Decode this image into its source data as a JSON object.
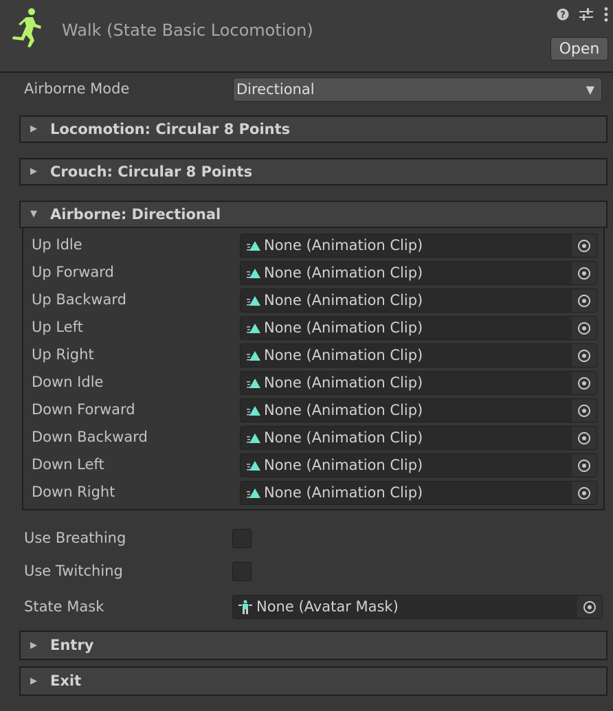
{
  "header": {
    "title": "Walk (State Basic Locomotion)",
    "open_button": "Open",
    "icons": [
      "runner-icon",
      "help-icon",
      "settings-sliders-icon",
      "more-vertical-icon"
    ],
    "runner_color": "#b5f16b"
  },
  "airborne_mode": {
    "label": "Airborne Mode",
    "value": "Directional"
  },
  "foldouts": [
    {
      "label": "Locomotion: Circular 8 Points",
      "expanded": false
    },
    {
      "label": "Crouch: Circular 8 Points",
      "expanded": false
    },
    {
      "label": "Airborne: Directional",
      "expanded": true
    }
  ],
  "airborne_clips": [
    {
      "label": "Up Idle",
      "value": "None (Animation Clip)"
    },
    {
      "label": "Up Forward",
      "value": "None (Animation Clip)"
    },
    {
      "label": "Up Backward",
      "value": "None (Animation Clip)"
    },
    {
      "label": "Up Left",
      "value": "None (Animation Clip)"
    },
    {
      "label": "Up Right",
      "value": "None (Animation Clip)"
    },
    {
      "label": "Down Idle",
      "value": "None (Animation Clip)"
    },
    {
      "label": "Down Forward",
      "value": "None (Animation Clip)"
    },
    {
      "label": "Down Backward",
      "value": "None (Animation Clip)"
    },
    {
      "label": "Down Left",
      "value": "None (Animation Clip)"
    },
    {
      "label": "Down Right",
      "value": "None (Animation Clip)"
    }
  ],
  "use_breathing": {
    "label": "Use Breathing",
    "checked": false
  },
  "use_twitching": {
    "label": "Use Twitching",
    "checked": false
  },
  "state_mask": {
    "label": "State Mask",
    "value": "None (Avatar Mask)"
  },
  "bottom_foldouts": [
    {
      "label": "Entry",
      "expanded": false
    },
    {
      "label": "Exit",
      "expanded": false
    }
  ],
  "accent_color": "#6ee6cf"
}
